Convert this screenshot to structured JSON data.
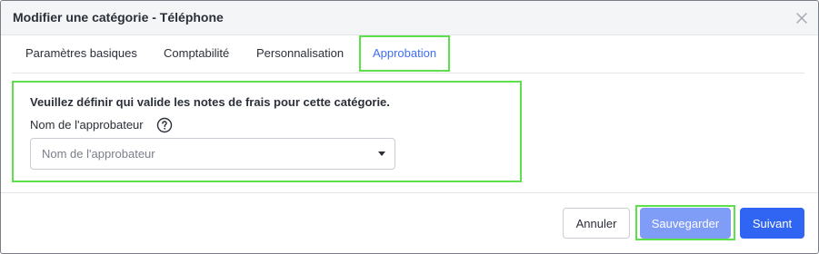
{
  "modal": {
    "title": "Modifier une catégorie - Téléphone",
    "close_icon": "close-icon"
  },
  "tabs": [
    {
      "label": "Paramètres basiques",
      "active": false
    },
    {
      "label": "Comptabilité",
      "active": false
    },
    {
      "label": "Personnalisation",
      "active": false
    },
    {
      "label": "Approbation",
      "active": true
    }
  ],
  "approval": {
    "heading": "Veuillez définir qui valide les notes de frais pour cette catégorie.",
    "approver_label": "Nom de l'approbateur",
    "help_icon": "help-circle-icon",
    "approver_select": {
      "placeholder": "Nom de l'approbateur",
      "value": ""
    }
  },
  "footer": {
    "cancel_label": "Annuler",
    "save_label": "Sauvegarder",
    "next_label": "Suivant"
  },
  "colors": {
    "accent": "#3064f2",
    "accent_disabled": "#7f9cf7",
    "active_tab": "#3f6ff5",
    "highlight": "#5ee04c"
  }
}
